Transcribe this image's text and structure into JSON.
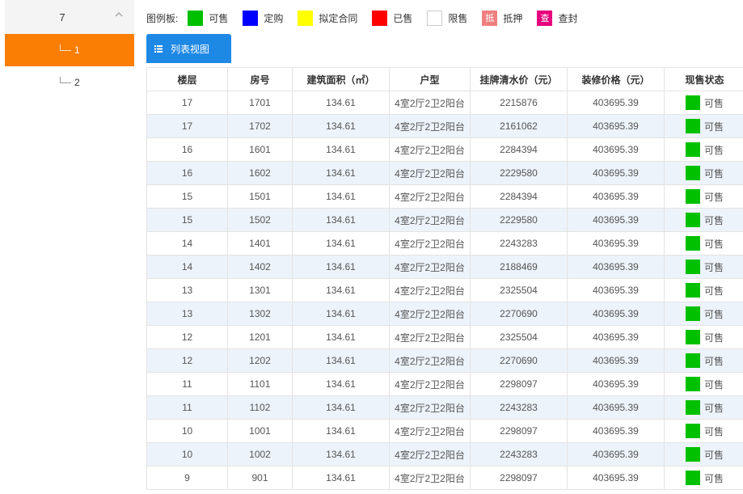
{
  "tree": {
    "group_label": "7",
    "items": [
      {
        "label": "1",
        "active": true
      },
      {
        "label": "2",
        "active": false
      }
    ]
  },
  "legend": {
    "title": "图例板:",
    "items": [
      {
        "label": "可售",
        "color": "#00c000",
        "glyph": ""
      },
      {
        "label": "定购",
        "color": "#0000ff",
        "glyph": ""
      },
      {
        "label": "拟定合同",
        "color": "#ffff00",
        "glyph": ""
      },
      {
        "label": "已售",
        "color": "#ff0000",
        "glyph": ""
      },
      {
        "label": "限售",
        "color": "#ffffff",
        "glyph": ""
      },
      {
        "label": "抵押",
        "color": "#f08080",
        "glyph": "抵"
      },
      {
        "label": "查封",
        "color": "#e6007e",
        "glyph": "查"
      }
    ]
  },
  "view_button": {
    "label": "列表视图"
  },
  "table": {
    "headers": [
      "楼层",
      "房号",
      "建筑面积（㎡）",
      "户型",
      "挂牌清水价（元）",
      "装修价格（元）",
      "现售状态"
    ],
    "status_color": "#00c000",
    "rows": [
      [
        "17",
        "1701",
        "134.61",
        "4室2厅2卫2阳台",
        "2215876",
        "403695.39",
        "可售"
      ],
      [
        "17",
        "1702",
        "134.61",
        "4室2厅2卫2阳台",
        "2161062",
        "403695.39",
        "可售"
      ],
      [
        "16",
        "1601",
        "134.61",
        "4室2厅2卫2阳台",
        "2284394",
        "403695.39",
        "可售"
      ],
      [
        "16",
        "1602",
        "134.61",
        "4室2厅2卫2阳台",
        "2229580",
        "403695.39",
        "可售"
      ],
      [
        "15",
        "1501",
        "134.61",
        "4室2厅2卫2阳台",
        "2284394",
        "403695.39",
        "可售"
      ],
      [
        "15",
        "1502",
        "134.61",
        "4室2厅2卫2阳台",
        "2229580",
        "403695.39",
        "可售"
      ],
      [
        "14",
        "1401",
        "134.61",
        "4室2厅2卫2阳台",
        "2243283",
        "403695.39",
        "可售"
      ],
      [
        "14",
        "1402",
        "134.61",
        "4室2厅2卫2阳台",
        "2188469",
        "403695.39",
        "可售"
      ],
      [
        "13",
        "1301",
        "134.61",
        "4室2厅2卫2阳台",
        "2325504",
        "403695.39",
        "可售"
      ],
      [
        "13",
        "1302",
        "134.61",
        "4室2厅2卫2阳台",
        "2270690",
        "403695.39",
        "可售"
      ],
      [
        "12",
        "1201",
        "134.61",
        "4室2厅2卫2阳台",
        "2325504",
        "403695.39",
        "可售"
      ],
      [
        "12",
        "1202",
        "134.61",
        "4室2厅2卫2阳台",
        "2270690",
        "403695.39",
        "可售"
      ],
      [
        "11",
        "1101",
        "134.61",
        "4室2厅2卫2阳台",
        "2298097",
        "403695.39",
        "可售"
      ],
      [
        "11",
        "1102",
        "134.61",
        "4室2厅2卫2阳台",
        "2243283",
        "403695.39",
        "可售"
      ],
      [
        "10",
        "1001",
        "134.61",
        "4室2厅2卫2阳台",
        "2298097",
        "403695.39",
        "可售"
      ],
      [
        "10",
        "1002",
        "134.61",
        "4室2厅2卫2阳台",
        "2243283",
        "403695.39",
        "可售"
      ],
      [
        "9",
        "901",
        "134.61",
        "4室2厅2卫2阳台",
        "2298097",
        "403695.39",
        "可售"
      ]
    ]
  }
}
